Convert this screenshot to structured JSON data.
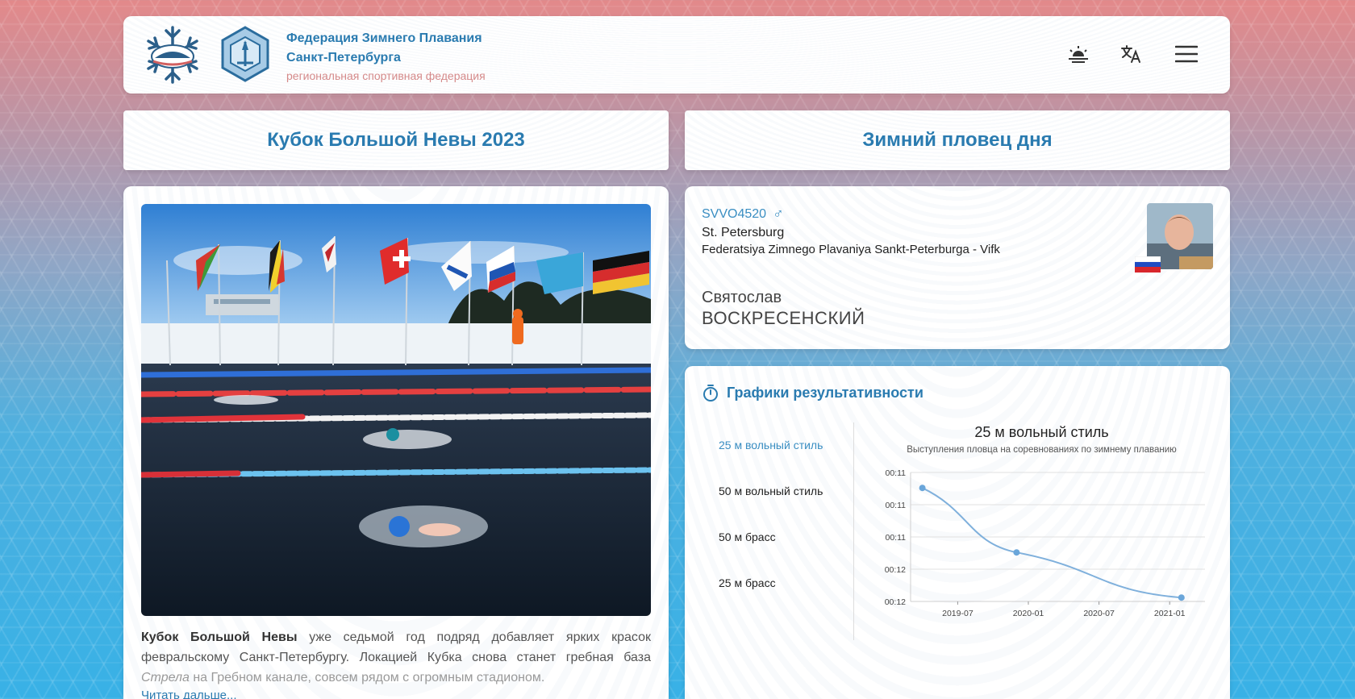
{
  "header": {
    "title_line1": "Федерация Зимнего Плавания",
    "title_line2": "Санкт-Петербурга",
    "subtitle": "региональная спортивная федерация",
    "icons": [
      "theme-toggle-icon",
      "translate-icon",
      "menu-icon"
    ]
  },
  "news": {
    "section_title": "Кубок Большой Невы 2023",
    "lead_bold": "Кубок Большой Невы",
    "lead_text": " уже седьмой год подряд добавляет ярких красок февральскому Санкт-Петербургу. Локацией Кубка снова станет гребная база ",
    "lead_italic": "Стрела",
    "lead_tail": " на Гребном канале, совсем рядом с огромным стадионом.",
    "read_more": "Читать дальше..."
  },
  "swimmer": {
    "section_title": "Зимний пловец дня",
    "id": "SVVO4520",
    "gender_symbol": "♂",
    "city": "St. Petersburg",
    "club": "Federatsiya Zimnego Plavaniya Sankt-Peterburga - Vifk",
    "first_name": "Святослав",
    "last_name": "ВОСКРЕСЕНСКИЙ",
    "flag": "russia-flag"
  },
  "charts": {
    "section_title": "Графики результативности",
    "tabs": [
      "25 м вольный стиль",
      "50 м вольный стиль",
      "50 м брасс",
      "25 м брасс"
    ],
    "active_tab": 0
  },
  "chart_data": {
    "type": "line",
    "title": "25 м вольный стиль",
    "subtitle": "Выступления пловца на соревнованиях по зимнему плаванию",
    "x_ticks": [
      "2019-07",
      "2020-01",
      "2020-07",
      "2021-01"
    ],
    "y_ticks": [
      "00:11",
      "00:11",
      "00:11",
      "00:12",
      "00:12"
    ],
    "ylim": [
      11.0,
      12.0
    ],
    "y_reversed": true,
    "x": [
      "2019-04",
      "2019-12",
      "2021-02"
    ],
    "values": [
      11.88,
      11.38,
      11.03
    ],
    "grid": true,
    "colors": {
      "line": "#7fb0dc",
      "point": "#6aa6da"
    }
  },
  "colors": {
    "accent": "#2a7bb0",
    "subtitle": "#d58a8a"
  }
}
